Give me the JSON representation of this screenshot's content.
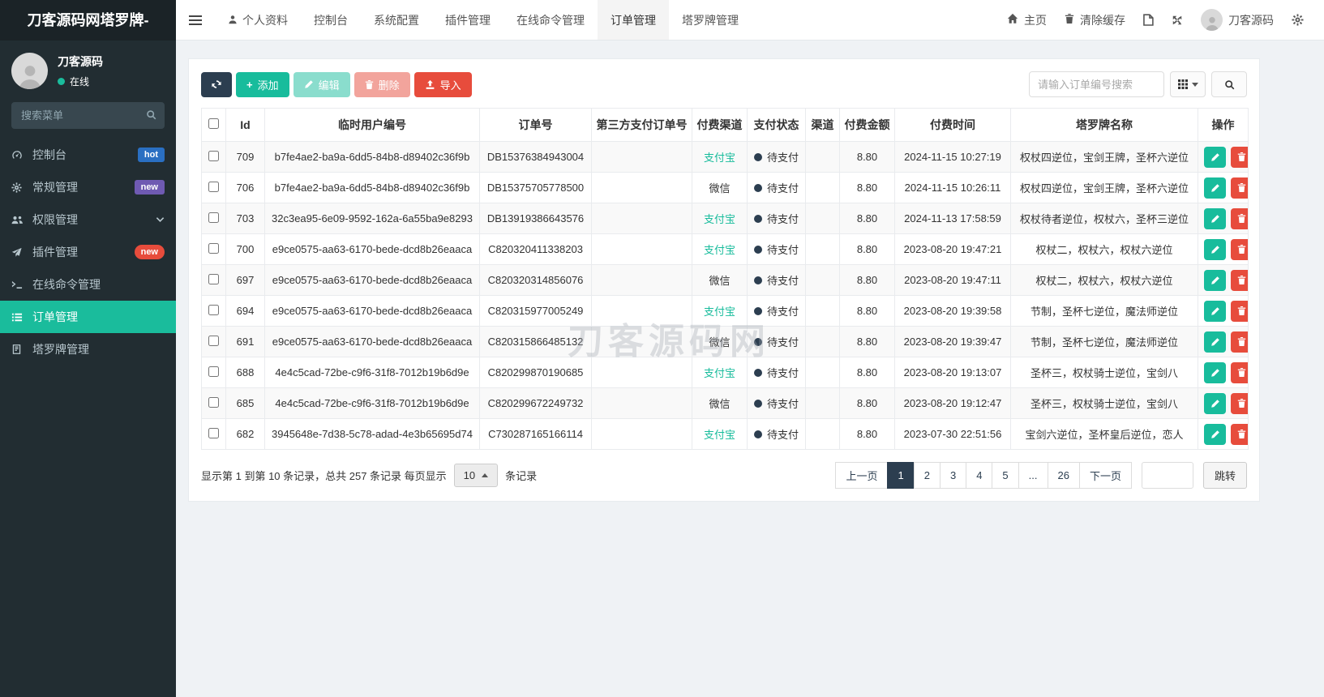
{
  "brand": {
    "title": "刀客源码网塔罗牌-"
  },
  "sidebar": {
    "user": {
      "name": "刀客源码",
      "status": "在线"
    },
    "search_placeholder": "搜索菜单",
    "items": [
      {
        "key": "console",
        "label": "控制台",
        "icon": "dashboard",
        "badge": "hot",
        "badge_color": "#2a6fc2",
        "pill": false,
        "active": false
      },
      {
        "key": "general",
        "label": "常规管理",
        "icon": "gear",
        "badge": "new",
        "badge_color": "#6f5ab2",
        "pill": false,
        "active": false
      },
      {
        "key": "permission",
        "label": "权限管理",
        "icon": "users",
        "chevron": true,
        "active": false
      },
      {
        "key": "plugin",
        "label": "插件管理",
        "icon": "plane",
        "badge": "new",
        "badge_color": "#e74c3c",
        "pill": true,
        "active": false
      },
      {
        "key": "command",
        "label": "在线命令管理",
        "icon": "terminal",
        "active": false
      },
      {
        "key": "order",
        "label": "订单管理",
        "icon": "list",
        "active": true
      },
      {
        "key": "tarot",
        "label": "塔罗牌管理",
        "icon": "card",
        "active": false
      }
    ]
  },
  "topnav": {
    "tabs": [
      {
        "key": "profile",
        "label": "个人资料",
        "icon": "user",
        "active": false
      },
      {
        "key": "console",
        "label": "控制台",
        "active": false
      },
      {
        "key": "sysconfig",
        "label": "系统配置",
        "active": false
      },
      {
        "key": "plugin",
        "label": "插件管理",
        "active": false
      },
      {
        "key": "command",
        "label": "在线命令管理",
        "active": false
      },
      {
        "key": "order",
        "label": "订单管理",
        "active": true
      },
      {
        "key": "tarot",
        "label": "塔罗牌管理",
        "active": false
      }
    ],
    "right": {
      "home": "主页",
      "clear_cache": "清除缓存",
      "username": "刀客源码"
    }
  },
  "toolbar": {
    "add_label": "添加",
    "edit_label": "编辑",
    "delete_label": "删除",
    "import_label": "导入",
    "search_placeholder": "请输入订单编号搜索"
  },
  "table": {
    "columns": [
      "Id",
      "临时用户编号",
      "订单号",
      "第三方支付订单号",
      "付费渠道",
      "支付状态",
      "渠道",
      "付费金额",
      "付费时间",
      "塔罗牌名称",
      "操作"
    ],
    "watermark": "刀客源码网",
    "rows": [
      {
        "id": "709",
        "user_no": "b7fe4ae2-ba9a-6dd5-84b8-d89402c36f9b",
        "order_no": "DB15376384943004",
        "third_no": "",
        "channel": "支付宝",
        "status": "待支付",
        "qudao": "",
        "amount": "8.80",
        "time": "2024-11-15 10:27:19",
        "tarot": "权杖四逆位，宝剑王牌，圣杯六逆位"
      },
      {
        "id": "706",
        "user_no": "b7fe4ae2-ba9a-6dd5-84b8-d89402c36f9b",
        "order_no": "DB15375705778500",
        "third_no": "",
        "channel": "微信",
        "status": "待支付",
        "qudao": "",
        "amount": "8.80",
        "time": "2024-11-15 10:26:11",
        "tarot": "权杖四逆位，宝剑王牌，圣杯六逆位"
      },
      {
        "id": "703",
        "user_no": "32c3ea95-6e09-9592-162a-6a55ba9e8293",
        "order_no": "DB13919386643576",
        "third_no": "",
        "channel": "支付宝",
        "status": "待支付",
        "qudao": "",
        "amount": "8.80",
        "time": "2024-11-13 17:58:59",
        "tarot": "权杖待者逆位，权杖六，圣杯三逆位"
      },
      {
        "id": "700",
        "user_no": "e9ce0575-aa63-6170-bede-dcd8b26eaaca",
        "order_no": "C820320411338203",
        "third_no": "",
        "channel": "支付宝",
        "status": "待支付",
        "qudao": "",
        "amount": "8.80",
        "time": "2023-08-20 19:47:21",
        "tarot": "权杖二，权杖六，权杖六逆位"
      },
      {
        "id": "697",
        "user_no": "e9ce0575-aa63-6170-bede-dcd8b26eaaca",
        "order_no": "C820320314856076",
        "third_no": "",
        "channel": "微信",
        "status": "待支付",
        "qudao": "",
        "amount": "8.80",
        "time": "2023-08-20 19:47:11",
        "tarot": "权杖二，权杖六，权杖六逆位"
      },
      {
        "id": "694",
        "user_no": "e9ce0575-aa63-6170-bede-dcd8b26eaaca",
        "order_no": "C820315977005249",
        "third_no": "",
        "channel": "支付宝",
        "status": "待支付",
        "qudao": "",
        "amount": "8.80",
        "time": "2023-08-20 19:39:58",
        "tarot": "节制，圣杯七逆位，魔法师逆位"
      },
      {
        "id": "691",
        "user_no": "e9ce0575-aa63-6170-bede-dcd8b26eaaca",
        "order_no": "C820315866485132",
        "third_no": "",
        "channel": "微信",
        "status": "待支付",
        "qudao": "",
        "amount": "8.80",
        "time": "2023-08-20 19:39:47",
        "tarot": "节制，圣杯七逆位，魔法师逆位"
      },
      {
        "id": "688",
        "user_no": "4e4c5cad-72be-c9f6-31f8-7012b19b6d9e",
        "order_no": "C820299870190685",
        "third_no": "",
        "channel": "支付宝",
        "status": "待支付",
        "qudao": "",
        "amount": "8.80",
        "time": "2023-08-20 19:13:07",
        "tarot": "圣杯三，权杖骑士逆位，宝剑八"
      },
      {
        "id": "685",
        "user_no": "4e4c5cad-72be-c9f6-31f8-7012b19b6d9e",
        "order_no": "C820299672249732",
        "third_no": "",
        "channel": "微信",
        "status": "待支付",
        "qudao": "",
        "amount": "8.80",
        "time": "2023-08-20 19:12:47",
        "tarot": "圣杯三，权杖骑士逆位，宝剑八"
      },
      {
        "id": "682",
        "user_no": "3945648e-7d38-5c78-adad-4e3b65695d74",
        "order_no": "C730287165166114",
        "third_no": "",
        "channel": "支付宝",
        "status": "待支付",
        "qudao": "",
        "amount": "8.80",
        "time": "2023-07-30 22:51:56",
        "tarot": "宝剑六逆位，圣杯皇后逆位，恋人"
      }
    ]
  },
  "pagination": {
    "info_prefix": "显示第 1 到第 10 条记录，总共 257 条记录 每页显示",
    "page_size": "10",
    "info_suffix": "条记录",
    "prev_label": "上一页",
    "next_label": "下一页",
    "pages": [
      "1",
      "2",
      "3",
      "4",
      "5",
      "...",
      "26"
    ],
    "active_page": "1",
    "jump_label": "跳转"
  },
  "colors": {
    "accent_teal": "#1abc9c",
    "danger_red": "#e74c3c",
    "dark_navy": "#2c3e50",
    "sidebar_bg": "#222d32",
    "link_green": "#18bc9c"
  }
}
